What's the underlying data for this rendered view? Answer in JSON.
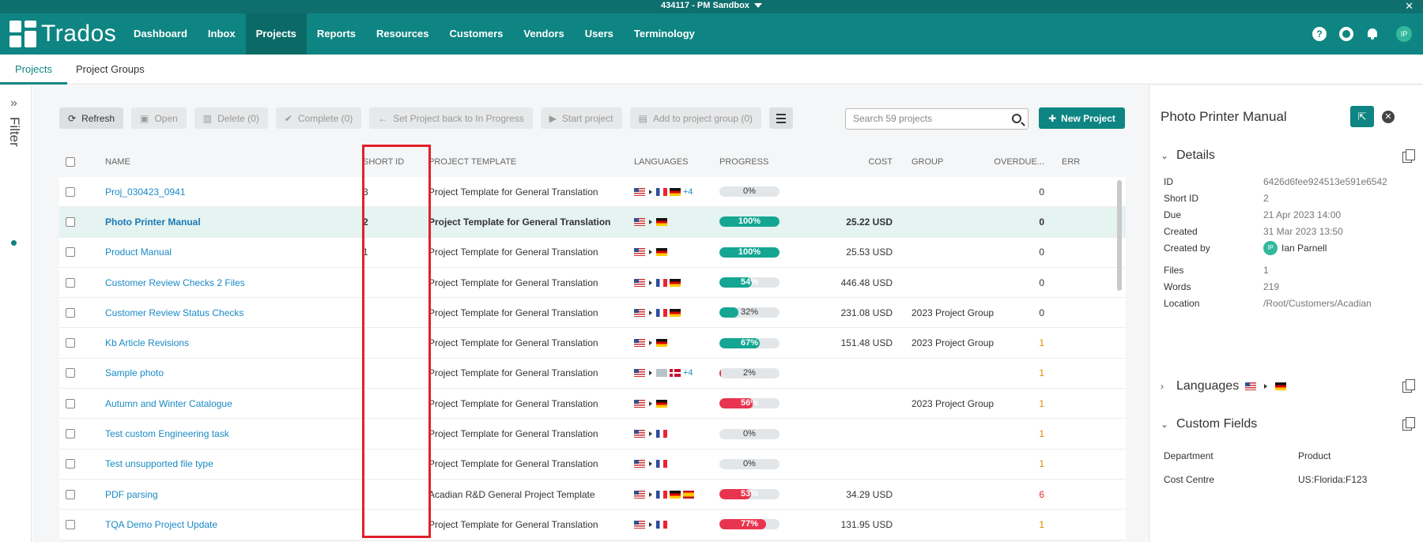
{
  "sysbar": {
    "env": "434117 - PM Sandbox"
  },
  "nav": {
    "logo": "Trados",
    "items": [
      "Dashboard",
      "Inbox",
      "Projects",
      "Reports",
      "Resources",
      "Customers",
      "Vendors",
      "Users",
      "Terminology"
    ],
    "active": "Projects",
    "help_icon": "?",
    "avatar": "IP"
  },
  "subnav": {
    "tabs": [
      "Projects",
      "Project Groups"
    ]
  },
  "filter": {
    "label": "Filter"
  },
  "toolbar": {
    "refresh": "Refresh",
    "open": "Open",
    "delete": "Delete (0)",
    "complete": "Complete (0)",
    "set_back": "Set Project back to In Progress",
    "start": "Start project",
    "add_group": "Add to project group (0)",
    "search_placeholder": "Search 59 projects",
    "new_project": "New Project"
  },
  "table": {
    "headers": [
      "NAME",
      "SHORT ID",
      "PROJECT TEMPLATE",
      "LANGUAGES",
      "PROGRESS",
      "COST",
      "GROUP",
      "OVERDUE...",
      "ERR"
    ],
    "rows": [
      {
        "name": "Proj_030423_0941",
        "short_id": "3",
        "template": "Project Template for General Translation",
        "langs": [
          "us",
          "arr",
          "fr",
          "de"
        ],
        "more": "+4",
        "progress": "0%",
        "pct": 0,
        "color": "",
        "cost": "",
        "group": "",
        "overdue": "0",
        "ovclass": ""
      },
      {
        "name": "Photo Printer Manual",
        "short_id": "2",
        "template": "Project Template for General Translation",
        "langs": [
          "us",
          "arr",
          "de"
        ],
        "more": "",
        "progress": "100%",
        "pct": 100,
        "color": "#14a693",
        "cost": "25.22 USD",
        "group": "",
        "overdue": "0",
        "ovclass": "",
        "selected": true
      },
      {
        "name": "Product Manual",
        "short_id": "1",
        "template": "Project Template for General Translation",
        "langs": [
          "us",
          "arr",
          "de"
        ],
        "more": "",
        "progress": "100%",
        "pct": 100,
        "color": "#14a693",
        "cost": "25.53 USD",
        "group": "",
        "overdue": "0",
        "ovclass": ""
      },
      {
        "name": "Customer Review Checks 2 Files",
        "short_id": "",
        "template": "Project Template for General Translation",
        "langs": [
          "us",
          "arr",
          "fr",
          "de"
        ],
        "more": "",
        "progress": "54%",
        "pct": 54,
        "color": "#14a693",
        "cost": "446.48 USD",
        "group": "",
        "overdue": "0",
        "ovclass": ""
      },
      {
        "name": "Customer Review Status Checks",
        "short_id": "",
        "template": "Project Template for General Translation",
        "langs": [
          "us",
          "arr",
          "fr",
          "de"
        ],
        "more": "",
        "progress": "32%",
        "pct": 32,
        "color": "#14a693",
        "cost": "231.08 USD",
        "group": "2023 Project Group",
        "overdue": "0",
        "ovclass": ""
      },
      {
        "name": "Kb Article Revisions",
        "short_id": "",
        "template": "Project Template for General Translation",
        "langs": [
          "us",
          "arr",
          "de"
        ],
        "more": "",
        "progress": "67%",
        "pct": 67,
        "color": "#14a693",
        "cost": "151.48 USD",
        "group": "2023 Project Group",
        "overdue": "1",
        "ovclass": "over-warn"
      },
      {
        "name": "Sample photo",
        "short_id": "",
        "template": "Project Template for General Translation",
        "langs": [
          "us",
          "arr",
          "gen",
          "dk"
        ],
        "more": "+4",
        "progress": "2%",
        "pct": 2,
        "color": "#e8344e",
        "cost": "",
        "group": "",
        "overdue": "1",
        "ovclass": "over-warn"
      },
      {
        "name": "Autumn and Winter Catalogue",
        "short_id": "",
        "template": "Project Template for General Translation",
        "langs": [
          "us",
          "arr",
          "de"
        ],
        "more": "",
        "progress": "56%",
        "pct": 56,
        "color": "#e8344e",
        "cost": "",
        "group": "2023 Project Group",
        "overdue": "1",
        "ovclass": "over-warn"
      },
      {
        "name": "Test custom Engineering task",
        "short_id": "",
        "template": "Project Template for General Translation",
        "langs": [
          "us",
          "arr",
          "fr"
        ],
        "more": "",
        "progress": "0%",
        "pct": 0,
        "color": "",
        "cost": "",
        "group": "",
        "overdue": "1",
        "ovclass": "over-warn"
      },
      {
        "name": "Test unsupported file type",
        "short_id": "",
        "template": "Project Template for General Translation",
        "langs": [
          "us",
          "arr",
          "fr"
        ],
        "more": "",
        "progress": "0%",
        "pct": 0,
        "color": "",
        "cost": "",
        "group": "",
        "overdue": "1",
        "ovclass": "over-warn"
      },
      {
        "name": "PDF parsing",
        "short_id": "",
        "template": "Acadian R&D General Project Template",
        "langs": [
          "us",
          "arr",
          "fr",
          "de",
          "es"
        ],
        "more": "",
        "progress": "53%",
        "pct": 53,
        "color": "#e8344e",
        "cost": "34.29 USD",
        "group": "",
        "overdue": "6",
        "ovclass": "over-red"
      },
      {
        "name": "TQA Demo Project Update",
        "short_id": "",
        "template": "Project Template for General Translation",
        "langs": [
          "us",
          "arr",
          "fr"
        ],
        "more": "",
        "progress": "77%",
        "pct": 77,
        "color": "#e8344e",
        "cost": "131.95 USD",
        "group": "",
        "overdue": "1",
        "ovclass": "over-warn"
      }
    ]
  },
  "panel": {
    "title": "Photo Printer Manual",
    "details_heading": "Details",
    "details": [
      {
        "label": "ID",
        "value": "6426d6fee924513e591e6542"
      },
      {
        "label": "Short ID",
        "value": "2"
      },
      {
        "label": "Due",
        "value": "21 Apr 2023 14:00"
      },
      {
        "label": "Created",
        "value": "31 Mar 2023 13:50"
      },
      {
        "label": "Created by",
        "value": "Ian Parnell"
      },
      {
        "label": "Files",
        "value": "1"
      },
      {
        "label": "Words",
        "value": "219"
      },
      {
        "label": "Location",
        "value": "/Root/Customers/Acadian"
      }
    ],
    "creator_initials": "IP",
    "languages_heading": "Languages",
    "custom_fields_heading": "Custom Fields",
    "custom_fields": [
      {
        "label": "Department",
        "value": "Product"
      },
      {
        "label": "Cost Centre",
        "value": "US:Florida:F123"
      }
    ]
  }
}
